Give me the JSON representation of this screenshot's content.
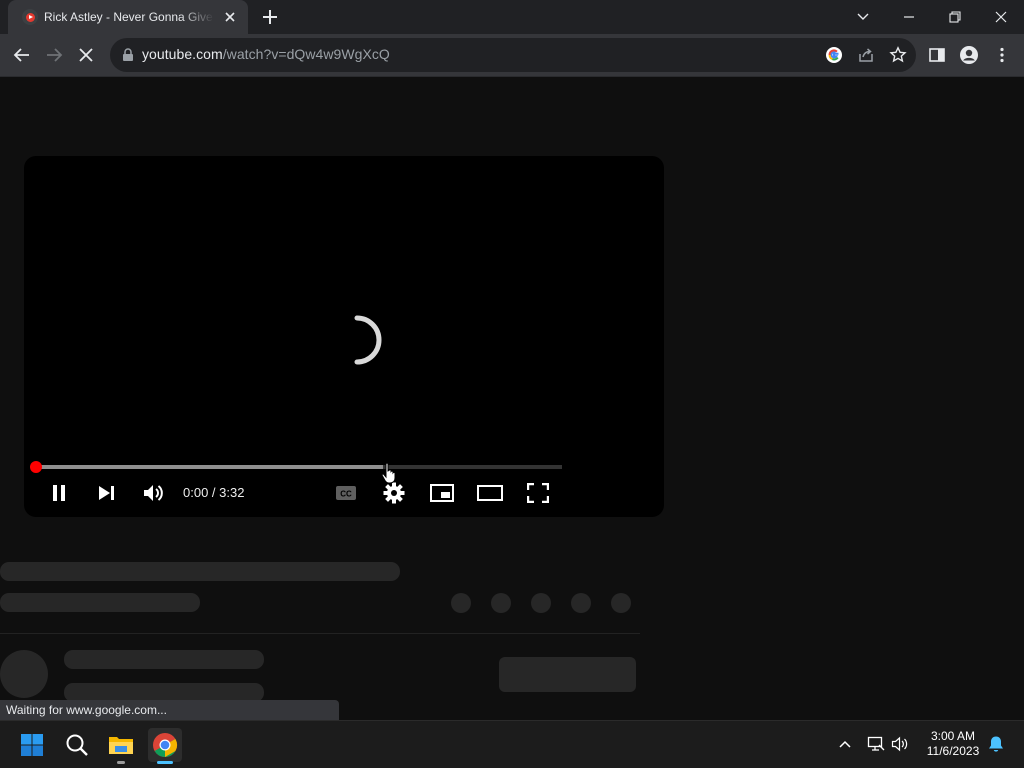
{
  "browser": {
    "tab": {
      "title": "Rick Astley - Never Gonna Give You Up"
    },
    "address": {
      "host": "youtube.com",
      "path": "/watch?v=dQw4w9WgXcQ"
    },
    "status_text": "Waiting for www.google.com..."
  },
  "player": {
    "time_display": "0:00 / 3:32",
    "buffered_fraction": 0.66,
    "played_fraction": 0.0
  },
  "taskbar": {
    "clock": {
      "time": "3:00 AM",
      "date": "11/6/2023"
    }
  },
  "colors": {
    "youtube_red": "#ff0000",
    "chrome_frame": "#202124",
    "chrome_toolbar": "#35363a",
    "page_bg": "#0f0f0f",
    "skeleton": "#272727",
    "taskbar_bg": "#1c1c1c",
    "windows_blue": "#0078d4"
  }
}
